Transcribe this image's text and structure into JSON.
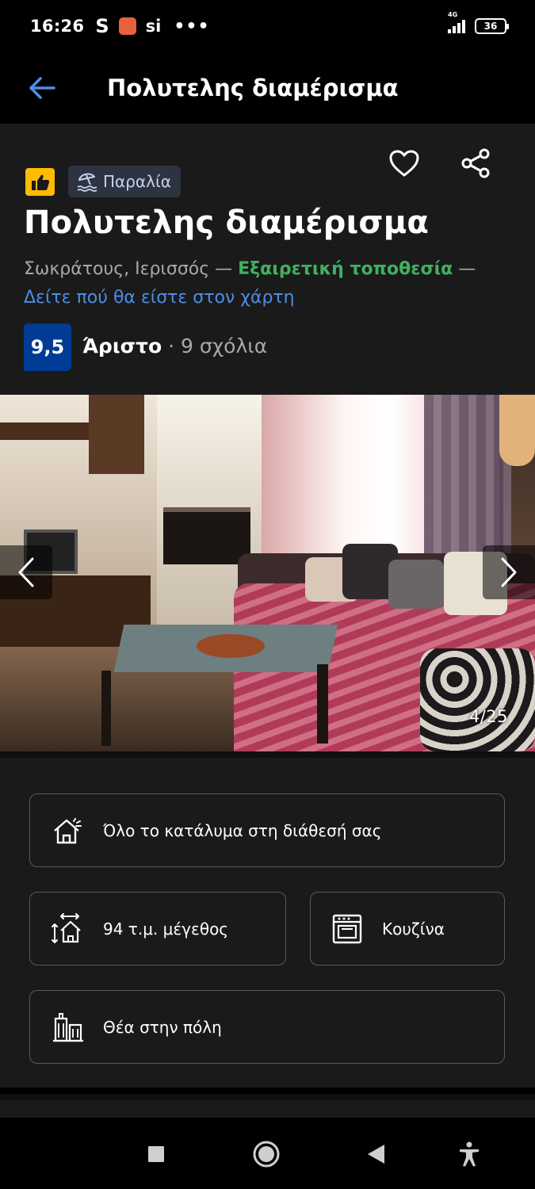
{
  "status_bar": {
    "time": "16:26",
    "app_letter": "S",
    "app_short": "si",
    "more": "•••",
    "network": "4G",
    "battery": "36"
  },
  "app_bar": {
    "title": "Πολυτελης διαμέρισμα",
    "back_icon": "arrow-left-icon"
  },
  "header": {
    "tag_label": "Παραλία",
    "title": "Πολυτελης διαμέρισμα",
    "address": "Σωκράτους, Ιερισσός",
    "dash": " — ",
    "location_badge": "Εξαιρετική τοποθεσία",
    "map_link": "Δείτε πού θα είστε στον χάρτη",
    "score": "9,5",
    "score_word": "Άριστο",
    "reviews": " · 9 σχόλια",
    "colors": {
      "score_bg": "#003b95",
      "location_green": "#3fb161",
      "link_blue": "#4d8ee6",
      "thumb_yellow": "#febb02"
    }
  },
  "photo": {
    "counter": "4/25"
  },
  "facilities": [
    {
      "icon": "house-icon",
      "label": "Όλο το κατάλυμα στη διάθεσή σας"
    },
    {
      "icon": "size-icon",
      "label": "94 τ.μ. μέγεθος"
    },
    {
      "icon": "oven-icon",
      "label": "Κουζίνα"
    },
    {
      "icon": "city-icon",
      "label": "Θέα στην πόλη"
    }
  ]
}
